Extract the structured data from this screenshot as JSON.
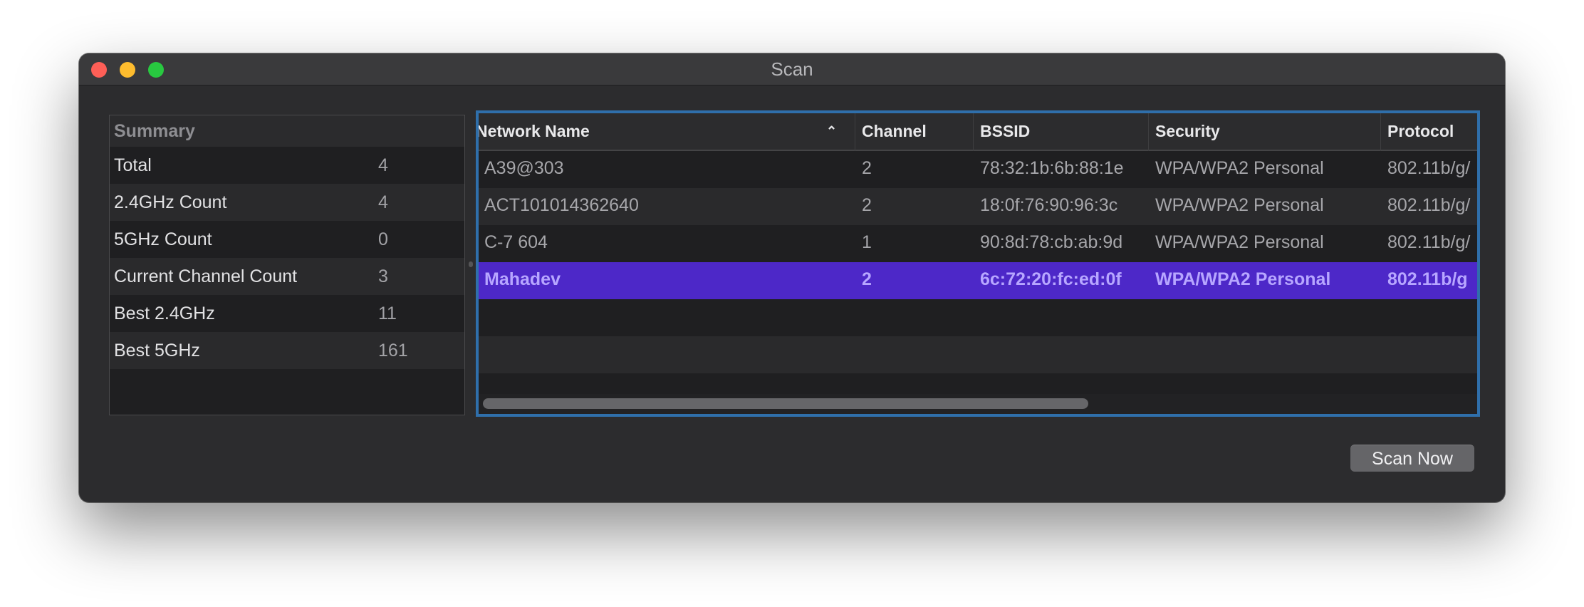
{
  "window": {
    "title": "Scan"
  },
  "summary": {
    "header": "Summary",
    "rows": [
      {
        "label": "Total",
        "value": "4"
      },
      {
        "label": "2.4GHz Count",
        "value": "4"
      },
      {
        "label": "5GHz Count",
        "value": "0"
      },
      {
        "label": "Current Channel Count",
        "value": "3"
      },
      {
        "label": "Best 2.4GHz",
        "value": "11"
      },
      {
        "label": "Best 5GHz",
        "value": "161"
      }
    ]
  },
  "networks": {
    "columns": {
      "name": "Network Name",
      "channel": "Channel",
      "bssid": "BSSID",
      "security": "Security",
      "protocol": "Protocol"
    },
    "sort": {
      "column": "name",
      "icon": "chevron-up-icon"
    },
    "rows": [
      {
        "name": "A39@303",
        "channel": "2",
        "bssid": "78:32:1b:6b:88:1e",
        "security": "WPA/WPA2 Personal",
        "protocol": "802.11b/g/"
      },
      {
        "name": "ACT101014362640",
        "channel": "2",
        "bssid": "18:0f:76:90:96:3c",
        "security": "WPA/WPA2 Personal",
        "protocol": "802.11b/g/"
      },
      {
        "name": "C-7 604",
        "channel": "1",
        "bssid": "90:8d:78:cb:ab:9d",
        "security": "WPA/WPA2 Personal",
        "protocol": "802.11b/g/"
      },
      {
        "name": "Mahadev",
        "channel": "2",
        "bssid": "6c:72:20:fc:ed:0f",
        "security": "WPA/WPA2 Personal",
        "protocol": "802.11b/g"
      }
    ],
    "selected_row": 3
  },
  "actions": {
    "scan_now": "Scan Now"
  },
  "colors": {
    "selection": "#4d28c8",
    "focus_ring": "#2f6fab",
    "close": "#fe5f57",
    "minimize": "#febc2e",
    "zoom": "#28c840"
  }
}
